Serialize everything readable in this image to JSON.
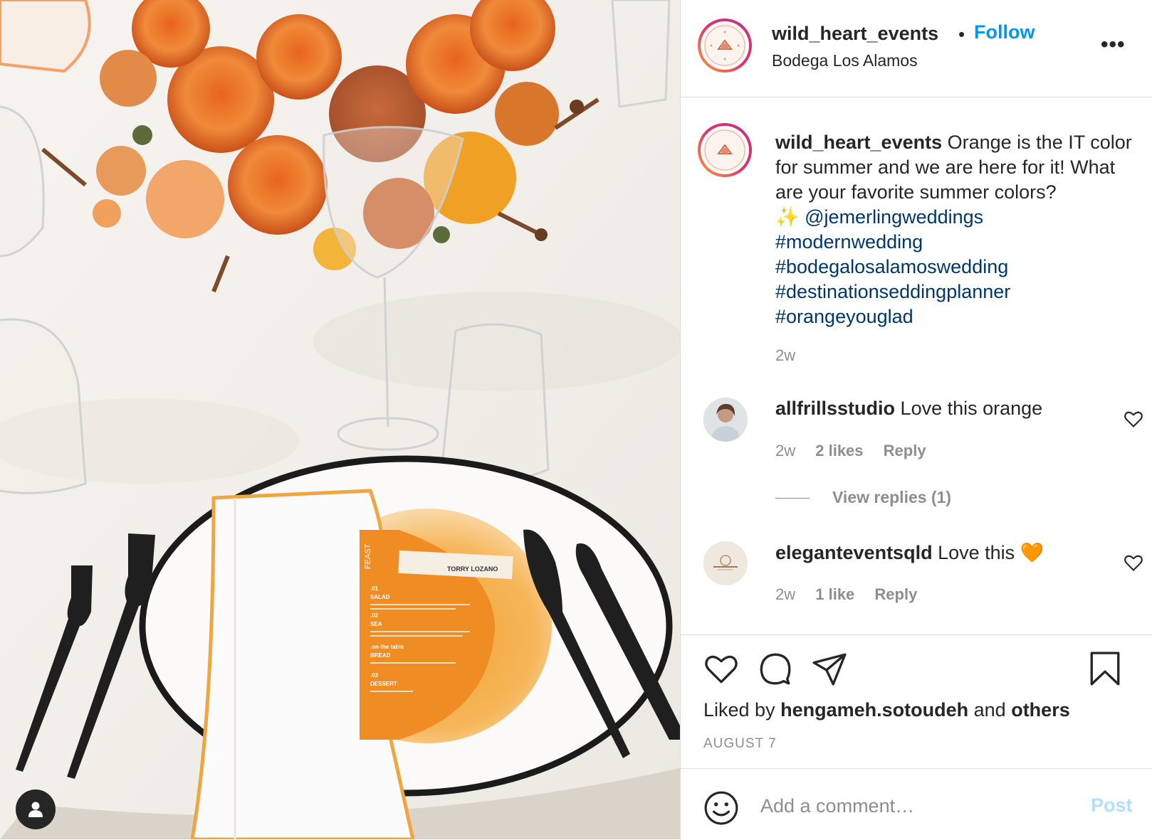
{
  "post": {
    "username": "wild_heart_events",
    "separator": "•",
    "follow_label": "Follow",
    "location": "Bodega Los Alamos",
    "more_label": "•••",
    "photo": {
      "menu_title": "FEAST",
      "place_card": "TORRY LOZANO",
      "menu_lines": [
        ".01",
        "SALAD",
        ".02",
        "SEA",
        ".on the table",
        "BREAD",
        ".03",
        "DESSERT"
      ]
    },
    "user_tag_icon": "person-icon"
  },
  "caption": {
    "username": "wild_heart_events",
    "text": "Orange is the IT color for summer and we are here for it! What are your favorite summer colors?",
    "sparkle": "✨",
    "mention": "@jemerlingweddings",
    "hashtags": [
      "#modernwedding",
      "#bodegalosalamoswedding",
      "#destinationseddingplanner",
      "#orangeyouglad"
    ],
    "time": "2w"
  },
  "comments": [
    {
      "username": "allfrillsstudio",
      "text": "Love this orange",
      "time": "2w",
      "likes": "2 likes",
      "reply_label": "Reply",
      "view_replies": "View replies (1)"
    },
    {
      "username": "eleganteventsqld",
      "text": "Love this",
      "emoji": "🧡",
      "time": "2w",
      "likes": "1 like",
      "reply_label": "Reply"
    }
  ],
  "actions": {
    "icons": [
      "heart-icon",
      "comment-icon",
      "share-icon",
      "bookmark-icon"
    ],
    "liked_prefix": "Liked by",
    "liked_user": "hengameh.sotoudeh",
    "liked_and": "and",
    "liked_others": "others",
    "date": "AUGUST 7"
  },
  "add_comment": {
    "placeholder": "Add a comment…",
    "post_label": "Post"
  },
  "colors": {
    "accent": "#0095f6",
    "link": "#00376b",
    "muted": "#8e8e8e",
    "post_disabled": "#b2dffc"
  }
}
